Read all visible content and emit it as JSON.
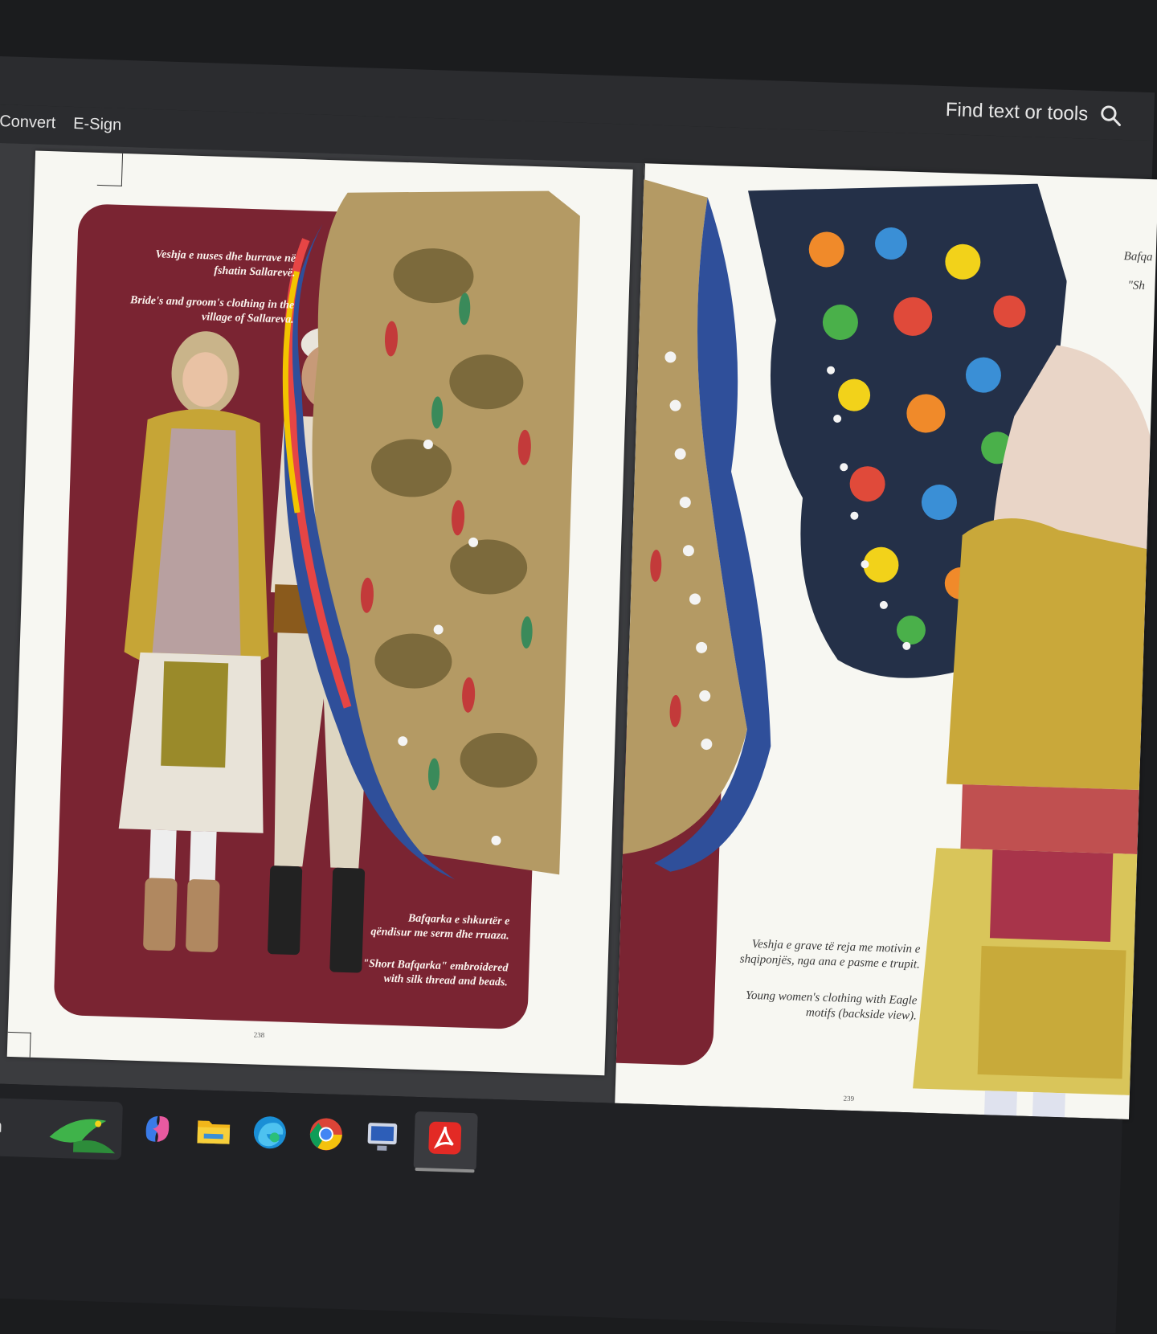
{
  "toolbar": {
    "search_placeholder": "Find text or tools",
    "menu": [
      "Convert",
      "E-Sign"
    ]
  },
  "left_page": {
    "caption_top_sq": "Veshja e nuses dhe burrave në fshatin Sallarevë.",
    "caption_top_en": "Bride's and groom's clothing in the village of Sallareva.",
    "caption_bottom_sq": "Bafqarka e shkurtër e qëndisur me serm dhe rruaza.",
    "caption_bottom_en": "\"Short Bafqarka\" embroidered with silk thread and beads.",
    "page_number": "238"
  },
  "right_page": {
    "edge_text_1": "Bafqa",
    "edge_text_2": "\"Sh",
    "caption_sq": "Veshja e grave të reja me motivin e shqiponjës, nga ana e pasme e trupit.",
    "caption_en": "Young women's clothing with Eagle motifs (backside view).",
    "page_number": "239"
  },
  "taskbar": {
    "search_label": "arch",
    "icons": [
      "copilot-icon",
      "file-explorer-icon",
      "edge-icon",
      "chrome-icon",
      "remote-desktop-icon",
      "acrobat-icon"
    ]
  },
  "colors": {
    "maroon": "#7a2432",
    "page": "#f7f7f2",
    "chrome_bg": "#2b2c2f",
    "taskbar_bg": "#202124"
  }
}
